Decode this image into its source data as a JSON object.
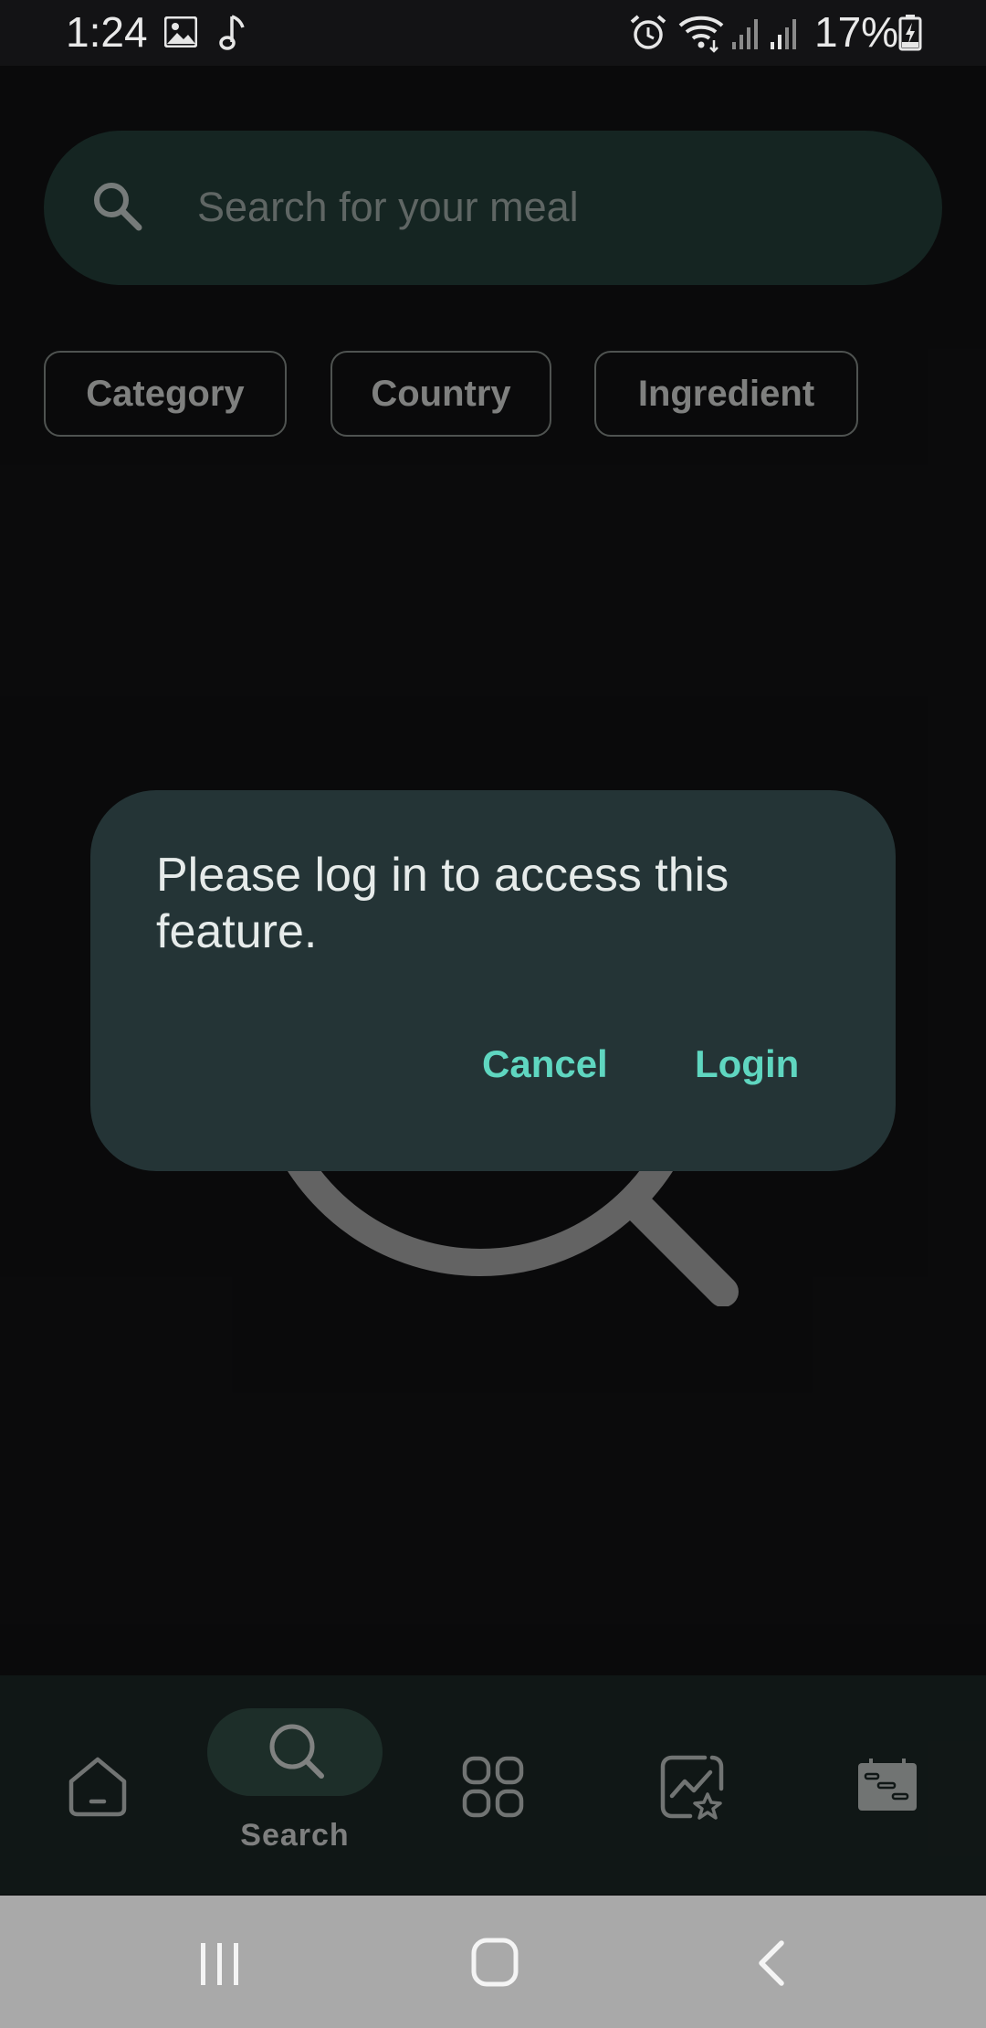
{
  "status_bar": {
    "time": "1:24",
    "battery": "17%",
    "icons": [
      "image-icon",
      "music-note-icon",
      "alarm-icon",
      "wifi-icon",
      "signal-icon",
      "signal-icon",
      "battery-charging-icon"
    ]
  },
  "search": {
    "placeholder": "Search for your meal",
    "icon": "search-icon"
  },
  "filters": [
    "Category",
    "Country",
    "Ingredient"
  ],
  "dialog": {
    "message": "Please log in to access this feature.",
    "cancel_label": "Cancel",
    "login_label": "Login"
  },
  "bottom_nav": {
    "items": [
      {
        "icon": "home-icon"
      },
      {
        "icon": "search-icon",
        "label": "Search",
        "selected": true
      },
      {
        "icon": "categories-grid-icon"
      },
      {
        "icon": "favorites-chart-icon"
      },
      {
        "icon": "meal-planner-icon"
      }
    ]
  },
  "system_nav": {
    "icons": [
      "recent-apps-icon",
      "home-button-icon",
      "back-icon"
    ]
  },
  "colors": {
    "background": "#131315",
    "accent": "#5fd6c0",
    "dialog": "#243436",
    "search_bar": "#26433d"
  }
}
